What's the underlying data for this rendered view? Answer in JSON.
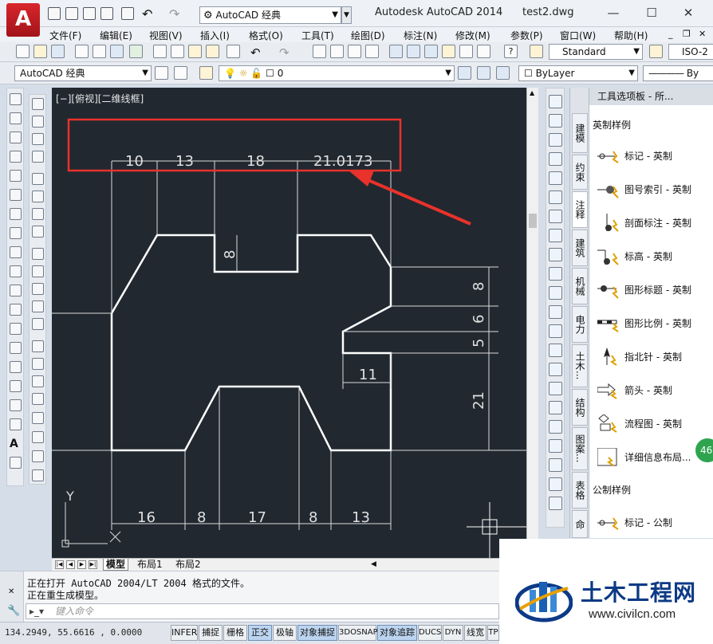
{
  "titlebar": {
    "logo_letter": "A",
    "workspace": "AutoCAD 经典",
    "app_title": "Autodesk AutoCAD 2014",
    "filename": "test2.dwg",
    "min_glyph": "—",
    "max_glyph": "☐",
    "close_glyph": "✕"
  },
  "menu": [
    "文件(F)",
    "编辑(E)",
    "视图(V)",
    "插入(I)",
    "格式(O)",
    "工具(T)",
    "绘图(D)",
    "标注(N)",
    "修改(M)",
    "参数(P)",
    "窗口(W)",
    "帮助(H)"
  ],
  "toolbar": {
    "text_style": "Standard",
    "dim_style": "ISO-2",
    "workspace_combo": "AutoCAD 经典",
    "layer": "0",
    "color": "ByLayer",
    "linetype": "By"
  },
  "viewport": {
    "label": "[−][俯视][二维线框]",
    "top_dims": [
      "10",
      "13",
      "18",
      "21.0173"
    ],
    "bottom_dims": [
      "16",
      "8",
      "17",
      "8",
      "13"
    ],
    "right_dims": [
      "8",
      "6",
      "5",
      "21"
    ],
    "slot_dim": "8",
    "notch_dim": "11",
    "ucs_y": "Y",
    "ucs_x": "X",
    "highlight_color": "#e8322b",
    "drawing_bg": "#212830"
  },
  "layout_tabs": [
    "模型",
    "布局1",
    "布局2"
  ],
  "palette": {
    "title": "工具选项板 - 所...",
    "tabs": [
      "建模",
      "约束",
      "注释",
      "建筑",
      "机械",
      "电力",
      "土木...",
      "结构",
      "图案...",
      "表格",
      "命令..."
    ],
    "section1": "英制样例",
    "items": [
      "标记 - 英制",
      "图号索引 - 英制",
      "剖面标注 - 英制",
      "标高 - 英制",
      "图形标题 - 英制",
      "图形比例 - 英制",
      "指北针 - 英制",
      "箭头 - 英制",
      "流程图 - 英制",
      "详细信息布局..."
    ],
    "section2": "公制样例",
    "items2": [
      "标记 - 公制"
    ],
    "badge": "46"
  },
  "command": {
    "line1": "正在打开 AutoCAD 2004/LT 2004 格式的文件。",
    "line2": "正在重生成模型。",
    "placeholder": "键入命令"
  },
  "status": {
    "coords": "134.2949, 55.6616 , 0.0000",
    "buttons": [
      {
        "label": "INFER",
        "on": false
      },
      {
        "label": "捕捉",
        "on": false
      },
      {
        "label": "栅格",
        "on": false
      },
      {
        "label": "正交",
        "on": true
      },
      {
        "label": "极轴",
        "on": false
      },
      {
        "label": "对象捕捉",
        "on": true
      },
      {
        "label": "3DOSNAP",
        "on": false
      },
      {
        "label": "对象追踪",
        "on": true
      },
      {
        "label": "DUCS",
        "on": false
      },
      {
        "label": "DYN",
        "on": false
      },
      {
        "label": "线宽",
        "on": false
      },
      {
        "label": "TP",
        "on": false
      }
    ]
  },
  "watermark": {
    "title": "土木工程网",
    "url": "www.civilcn.com"
  }
}
